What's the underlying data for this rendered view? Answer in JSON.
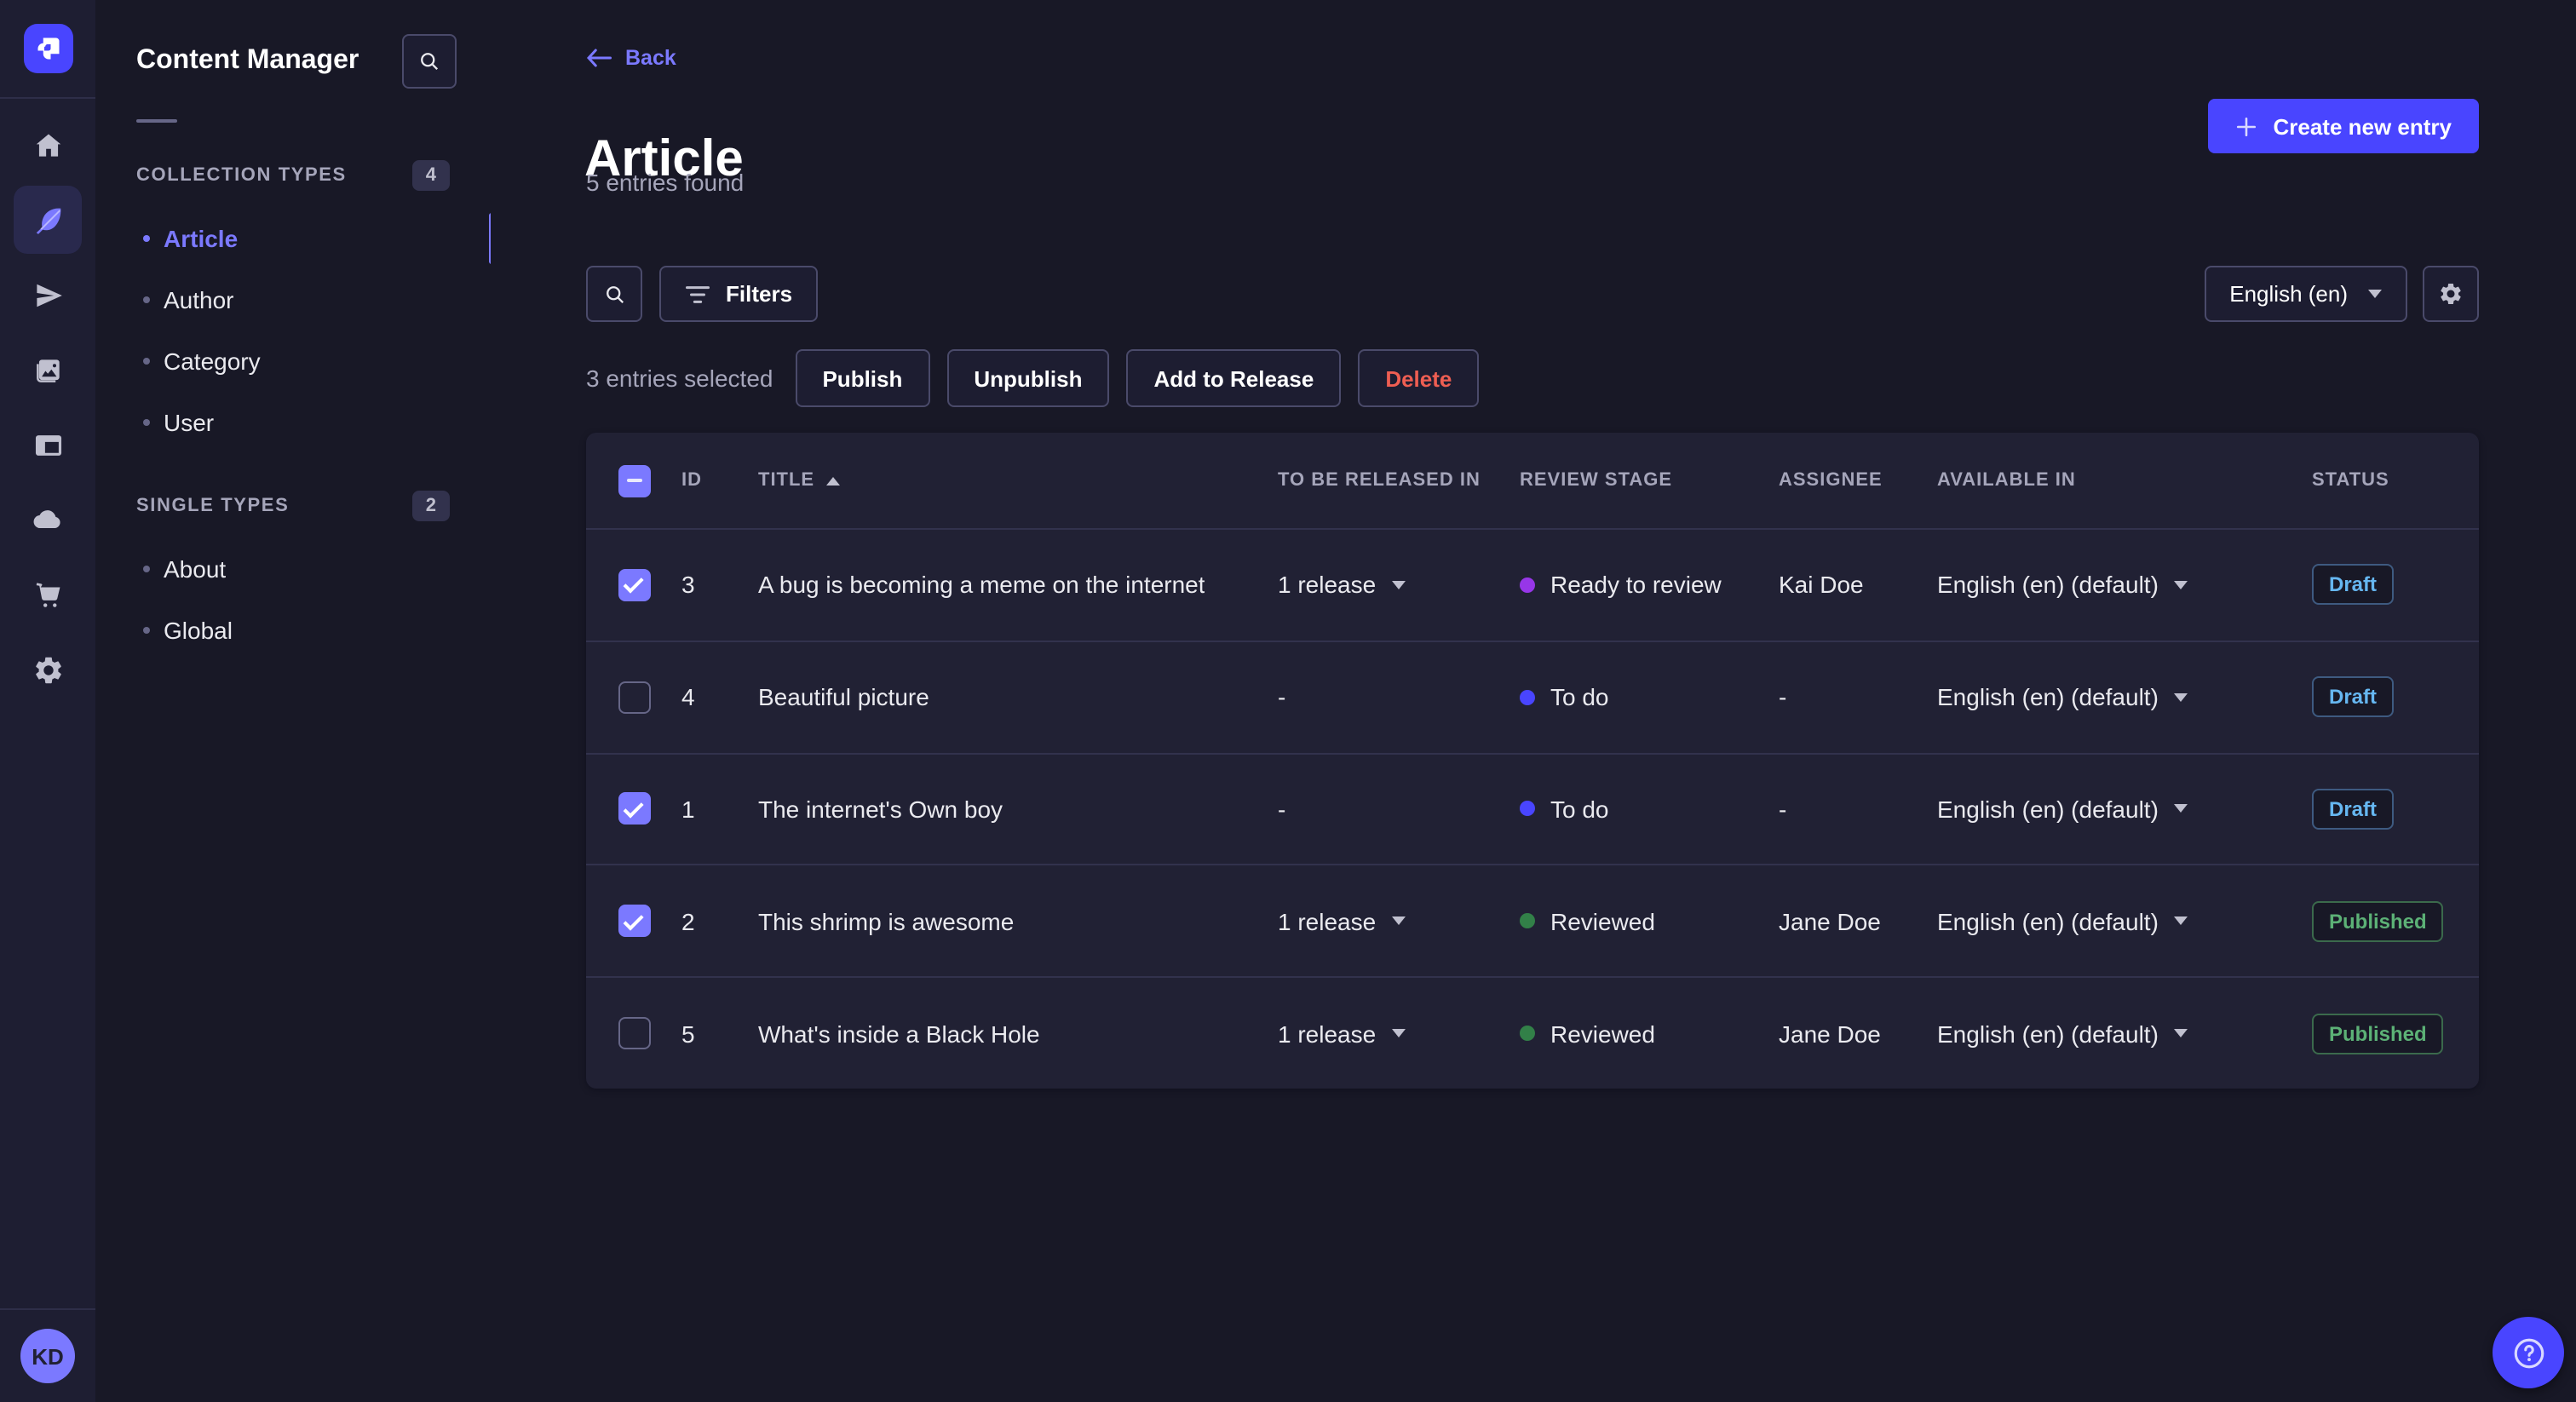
{
  "nav_rail": {
    "logo_name": "strapi-logo",
    "items": [
      {
        "label": "Home",
        "icon": "home-icon",
        "active": false
      },
      {
        "label": "Content Manager",
        "icon": "feather-icon",
        "active": true
      },
      {
        "label": "Releases",
        "icon": "paper-plane-icon",
        "active": false
      },
      {
        "label": "Media Library",
        "icon": "images-icon",
        "active": false
      },
      {
        "label": "Content-Type Builder",
        "icon": "layout-icon",
        "active": false
      },
      {
        "label": "Cloud",
        "icon": "cloud-icon",
        "active": false
      },
      {
        "label": "Marketplace",
        "icon": "cart-icon",
        "active": false
      },
      {
        "label": "Settings",
        "icon": "gear-icon",
        "active": false
      }
    ],
    "avatar_initials": "KD"
  },
  "sidebar": {
    "title": "Content Manager",
    "sections": [
      {
        "label": "COLLECTION TYPES",
        "count": "4",
        "items": [
          {
            "label": "Article",
            "active": true
          },
          {
            "label": "Author",
            "active": false
          },
          {
            "label": "Category",
            "active": false
          },
          {
            "label": "User",
            "active": false
          }
        ]
      },
      {
        "label": "SINGLE TYPES",
        "count": "2",
        "items": [
          {
            "label": "About",
            "active": false
          },
          {
            "label": "Global",
            "active": false
          }
        ]
      }
    ]
  },
  "header": {
    "back_label": "Back",
    "title": "Article",
    "subtitle": "5 entries found",
    "create_button": "Create new entry"
  },
  "toolbar": {
    "filters_label": "Filters",
    "locale_label": "English (en)"
  },
  "selection": {
    "text": "3 entries selected",
    "publish": "Publish",
    "unpublish": "Unpublish",
    "add_to_release": "Add to Release",
    "delete": "Delete"
  },
  "table": {
    "columns": {
      "id": "ID",
      "title": "TITLE",
      "release": "TO BE RELEASED IN",
      "stage": "REVIEW STAGE",
      "assignee": "ASSIGNEE",
      "available": "AVAILABLE IN",
      "status": "STATUS"
    },
    "rows": [
      {
        "checked": true,
        "id": "3",
        "title": "A bug is becoming a meme on the internet",
        "release": "1 release",
        "release_caret": true,
        "stage": "Ready to review",
        "stage_color": "#9736E8",
        "assignee": "Kai Doe",
        "locale": "English (en) (default)",
        "status": "Draft"
      },
      {
        "checked": false,
        "id": "4",
        "title": "Beautiful picture",
        "release": "-",
        "release_caret": false,
        "stage": "To do",
        "stage_color": "#4945FF",
        "assignee": "-",
        "locale": "English (en) (default)",
        "status": "Draft"
      },
      {
        "checked": true,
        "id": "1",
        "title": "The internet's Own boy",
        "release": "-",
        "release_caret": false,
        "stage": "To do",
        "stage_color": "#4945FF",
        "assignee": "-",
        "locale": "English (en) (default)",
        "status": "Draft"
      },
      {
        "checked": true,
        "id": "2",
        "title": "This shrimp is awesome",
        "release": "1 release",
        "release_caret": true,
        "stage": "Reviewed",
        "stage_color": "#328048",
        "assignee": "Jane Doe",
        "locale": "English (en) (default)",
        "status": "Published"
      },
      {
        "checked": false,
        "id": "5",
        "title": "What's inside a Black Hole",
        "release": "1 release",
        "release_caret": true,
        "stage": "Reviewed",
        "stage_color": "#328048",
        "assignee": "Jane Doe",
        "locale": "English (en) (default)",
        "status": "Published"
      }
    ]
  },
  "colors": {
    "primary": "#4945FF",
    "primary_light": "#7B79FF",
    "background": "#181826",
    "surface": "#212134",
    "border": "#32324D",
    "muted_text": "#A5A5BA",
    "draft": "#66B7F1",
    "published": "#5CB176",
    "danger": "#EE5E52"
  }
}
